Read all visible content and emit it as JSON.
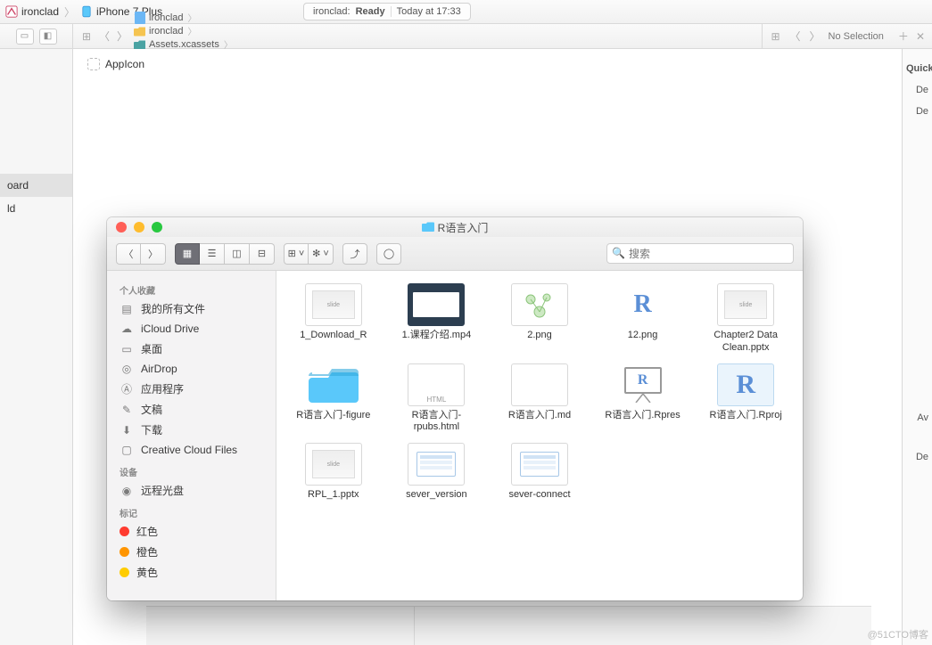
{
  "topbar": {
    "scheme": "ironclad",
    "device": "iPhone 7 Plus",
    "status_app": "ironclad:",
    "status_state": "Ready",
    "status_time": "Today at 17:33"
  },
  "second_row": {
    "breadcrumb": [
      {
        "icon": "doc-blue",
        "label": "ironclad"
      },
      {
        "icon": "folder-yellow",
        "label": "ironclad"
      },
      {
        "icon": "folder-teal",
        "label": "Assets.xcassets"
      },
      {
        "icon": "",
        "label": "No Selection"
      }
    ],
    "right_label": "No Selection"
  },
  "left_panel": {
    "items": [
      "oard",
      "ld"
    ]
  },
  "canvas": {
    "appicon_label": "AppIcon"
  },
  "inspector": {
    "header": "Quick H",
    "rows": [
      "De",
      "De",
      "Av",
      "De"
    ]
  },
  "finder": {
    "title": "R语言入门",
    "search_placeholder": "搜索",
    "sidebar": {
      "sections": [
        {
          "header": "个人收藏",
          "items": [
            {
              "icon": "all-files",
              "label": "我的所有文件"
            },
            {
              "icon": "cloud",
              "label": "iCloud Drive"
            },
            {
              "icon": "desktop",
              "label": "桌面"
            },
            {
              "icon": "airdrop",
              "label": "AirDrop"
            },
            {
              "icon": "apps",
              "label": "应用程序"
            },
            {
              "icon": "docs",
              "label": "文稿"
            },
            {
              "icon": "downloads",
              "label": "下载"
            },
            {
              "icon": "folder",
              "label": "Creative Cloud Files"
            }
          ]
        },
        {
          "header": "设备",
          "items": [
            {
              "icon": "disc",
              "label": "远程光盘"
            }
          ]
        },
        {
          "header": "标记",
          "items": [
            {
              "icon": "tag",
              "color": "#ff3b30",
              "label": "红色"
            },
            {
              "icon": "tag",
              "color": "#ff9500",
              "label": "橙色"
            },
            {
              "icon": "tag",
              "color": "#ffcc00",
              "label": "黄色"
            }
          ]
        }
      ]
    },
    "files": [
      {
        "name": "1_Download_R",
        "kind": "pptx"
      },
      {
        "name": "1.课程介绍.mp4",
        "kind": "video"
      },
      {
        "name": "2.png",
        "kind": "png-green"
      },
      {
        "name": "12.png",
        "kind": "r-icon"
      },
      {
        "name": "Chapter2 Data Clean.pptx",
        "kind": "pptx"
      },
      {
        "name": "R语言入门-figure",
        "kind": "folder"
      },
      {
        "name": "R语言入门-rpubs.html",
        "kind": "html"
      },
      {
        "name": "R语言入门.md",
        "kind": "blank"
      },
      {
        "name": "R语言入门.Rpres",
        "kind": "rpres"
      },
      {
        "name": "R语言入门.Rproj",
        "kind": "rproj"
      },
      {
        "name": "RPL_1.pptx",
        "kind": "pptx"
      },
      {
        "name": "sever_version",
        "kind": "screenshot"
      },
      {
        "name": "sever-connect",
        "kind": "screenshot"
      }
    ]
  },
  "watermark": "@51CTO博客"
}
